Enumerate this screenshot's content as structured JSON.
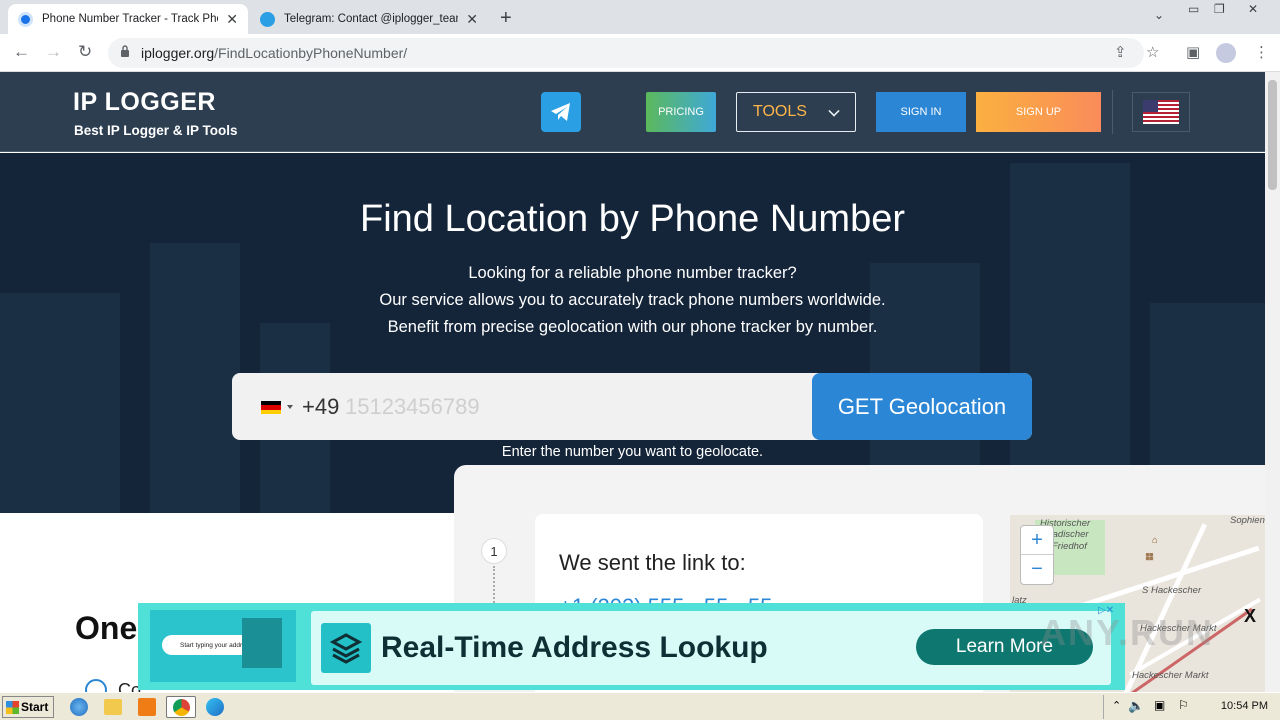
{
  "browser": {
    "tabs": [
      {
        "title": "Phone Number Tracker - Track Phone",
        "active": true
      },
      {
        "title": "Telegram: Contact @iplogger_team",
        "active": false
      }
    ],
    "url_host": "iplogger.org",
    "url_path": "/FindLocationbyPhoneNumber/"
  },
  "header": {
    "logo": "IP LOGGER",
    "tagline": "Best IP Logger & IP Tools",
    "pricing": "PRICING",
    "tools": "TOOLS",
    "signin": "SIGN IN",
    "signup": "SIGN UP"
  },
  "hero": {
    "title": "Find Location by Phone Number",
    "line1": "Looking for a reliable phone number tracker?",
    "line2": "Our service allows you to accurately track phone numbers worldwide.",
    "line3": "Benefit from precise geolocation with our phone tracker by number.",
    "country_code": "+49",
    "phone_placeholder": "15123456789",
    "button": "GET Geolocation",
    "hint": "Enter the number you want to geolocate."
  },
  "demo": {
    "step": "1",
    "card_title": "We sent the link to:",
    "card_phone": "+1 (202) 555 - 55 - 55",
    "map_labels": [
      "Historischer",
      "Friedhof",
      "S Hackescher",
      "Hackescher Markt",
      "Hackescher Markt",
      "latz"
    ],
    "map_place_marks": [
      "Sophien-",
      "tadischer"
    ]
  },
  "section": {
    "heading": "One",
    "item": "Co"
  },
  "ad": {
    "title": "Real-Time Address Lookup",
    "button": "Learn More",
    "thumb_text": "Start typing your address",
    "close": "X"
  },
  "watermark": "ANY.RUN",
  "taskbar": {
    "start": "Start",
    "time": "10:54 PM"
  }
}
